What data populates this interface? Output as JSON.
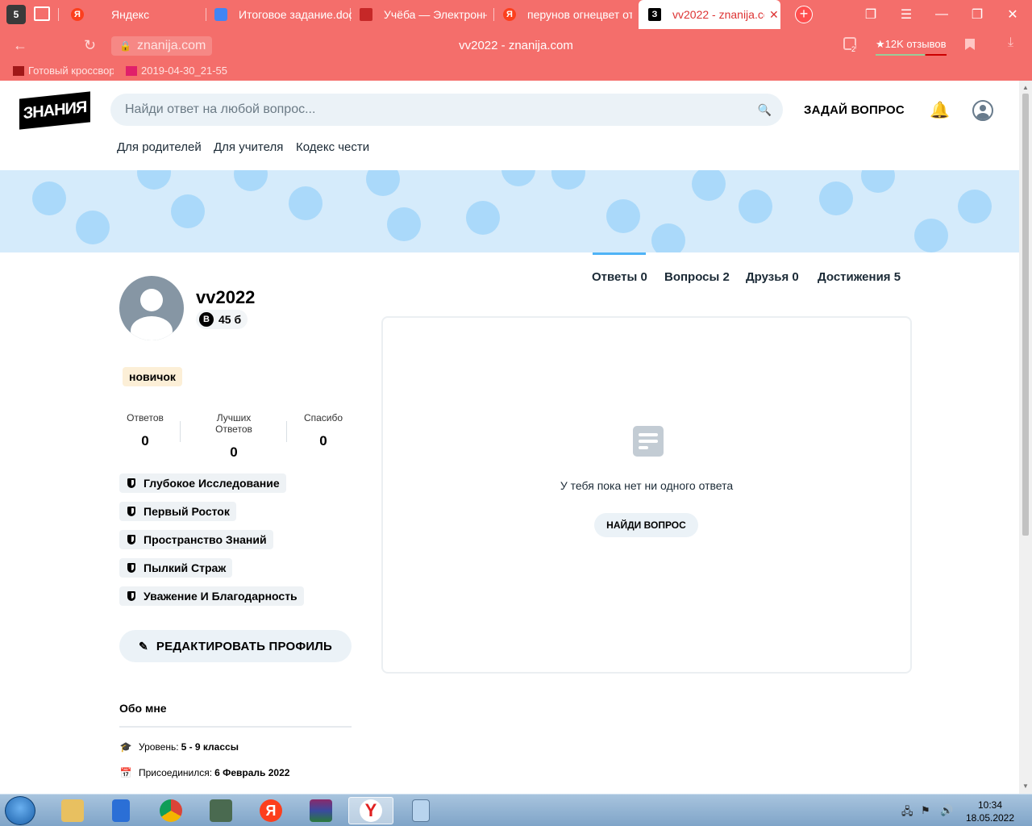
{
  "browser": {
    "tabs": [
      {
        "label": "Яндекс",
        "favicon": "Я",
        "color": "#fc3f1d"
      },
      {
        "label": "Итоговое задание.doc",
        "favicon": "doc",
        "color": "#4285f4"
      },
      {
        "label": "Учёба — Электронный",
        "favicon": "book",
        "color": "#c62828"
      },
      {
        "label": "перунов огнецвет отз",
        "favicon": "Я",
        "color": "#fc3f1d"
      },
      {
        "label": "vv2022 - znanija.com",
        "favicon": "З",
        "color": "#000000"
      }
    ],
    "tab_count_badge": "5",
    "url": "znanija.com",
    "page_title": "vv2022 - znanija.com",
    "reviews": "★12K отзывов",
    "notif_count": "2",
    "bookmarks": [
      "Готовый кроссвор",
      "2019-04-30_21-55"
    ]
  },
  "header": {
    "logo": "ЗНАНИЯ",
    "search_placeholder": "Найди ответ на любой вопрос...",
    "ask_button": "ЗАДАЙ ВОПРОС",
    "subnav": [
      "Для родителей",
      "Для учителя",
      "Кодекс чести"
    ]
  },
  "profile": {
    "username": "vv2022",
    "points": "45 б",
    "rank": "новичок",
    "stats": [
      {
        "label": "Ответов",
        "value": "0"
      },
      {
        "label": "Лучших Ответов",
        "value": "0"
      },
      {
        "label": "Спасибо",
        "value": "0"
      }
    ],
    "badges": [
      "Глубокое Исследование",
      "Первый Росток",
      "Пространство Знаний",
      "Пылкий Страж",
      "Уважение И Благодарность"
    ],
    "edit_button": "РЕДАКТИРОВАТЬ ПРОФИЛЬ",
    "about_title": "Обо мне",
    "level_label": "Уровень:",
    "level_value": "5 - 9 классы",
    "joined_label": "Присоединился:",
    "joined_value": "6 Февраль 2022"
  },
  "content_tabs": [
    "Ответы 0",
    "Вопросы 2",
    "Друзья 0",
    "Достижения 5"
  ],
  "empty_state": {
    "message": "У тебя пока нет ни одного ответа",
    "button": "НАЙДИ ВОПРОС"
  },
  "taskbar": {
    "time": "10:34",
    "date": "18.05.2022"
  }
}
